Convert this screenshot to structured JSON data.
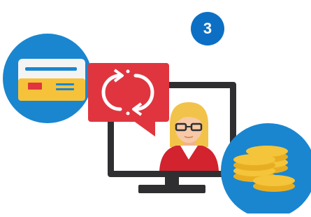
{
  "step": {
    "number": "3"
  },
  "colors": {
    "blue": "#1a86d0",
    "step_blue": "#0c6fc4",
    "red": "#e0353f",
    "red_dark": "#c9262f",
    "card_yellow": "#f6c23a",
    "card_white": "#f4f4f4",
    "coin_gold": "#f4c43a",
    "monitor": "#2f2f31",
    "screen": "#ffffff",
    "hair": "#f2c34a",
    "skin": "#f7c9a6",
    "suit": "#d2232f"
  },
  "icons": [
    "credit-card-icon",
    "refresh-arrows-icon",
    "businesswoman-avatar-icon",
    "coin-stack-icon",
    "computer-monitor-icon"
  ]
}
